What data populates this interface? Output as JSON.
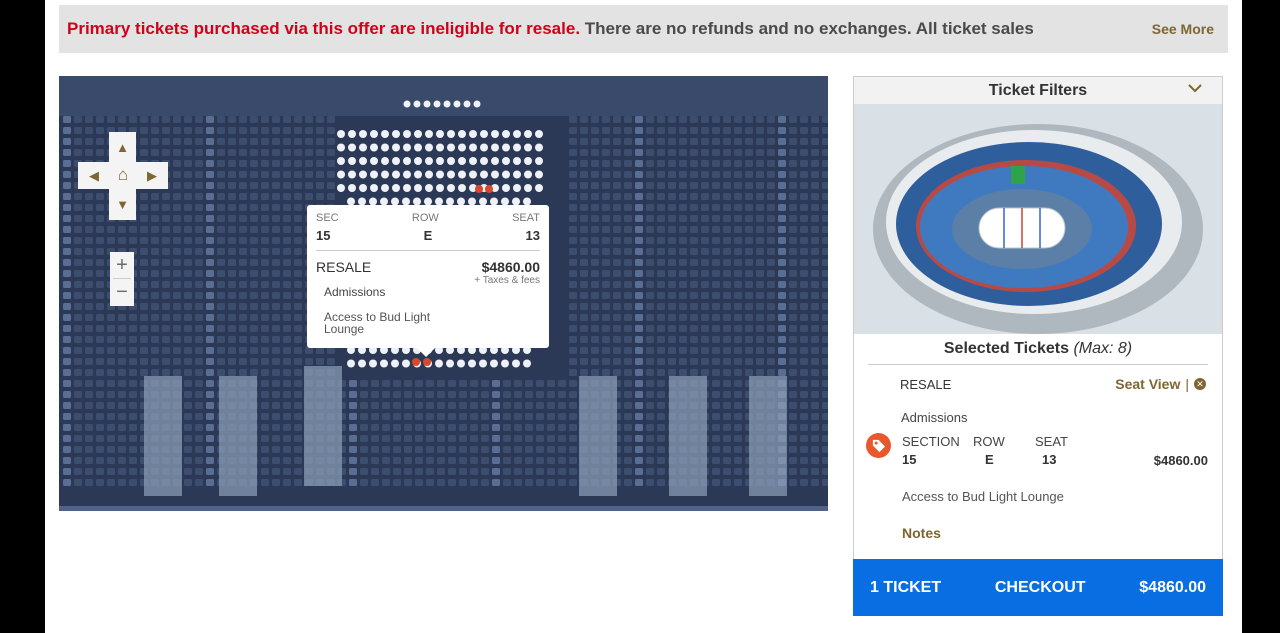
{
  "banner": {
    "highlight": "Primary tickets purchased via this offer are ineligible for resale.",
    "text": " There are no refunds and no exchanges. All ticket sales are final. Available",
    "see_more": "See More"
  },
  "map": {
    "popup": {
      "sec_label": "SEC",
      "sec_value": "15",
      "row_label": "ROW",
      "row_value": "E",
      "seat_label": "SEAT",
      "seat_value": "13",
      "type": "RESALE",
      "price": "$4860.00",
      "admissions": "Admissions",
      "taxes": "+ Taxes & fees",
      "access": "Access to Bud Light Lounge"
    }
  },
  "filters": {
    "title": "Ticket Filters",
    "selected_title": "Selected Tickets",
    "selected_max": "(Max: 8)",
    "ticket": {
      "type": "RESALE",
      "seat_view": "Seat View",
      "admissions": "Admissions",
      "section_label": "SECTION",
      "section_value": "15",
      "row_label": "ROW",
      "row_value": "E",
      "seat_label": "SEAT",
      "seat_value": "13",
      "price": "$4860.00",
      "access": "Access to Bud Light Lounge",
      "notes": "Notes"
    },
    "checkout": {
      "count": "1 TICKET",
      "label": "CHECKOUT",
      "total": "$4860.00"
    }
  },
  "colors": {
    "accent": "#7d6631",
    "banner_red": "#d0021b",
    "checkout_blue": "#0a6ee3",
    "tag_orange": "#e9572d",
    "selected_seat": "#d9482b"
  }
}
